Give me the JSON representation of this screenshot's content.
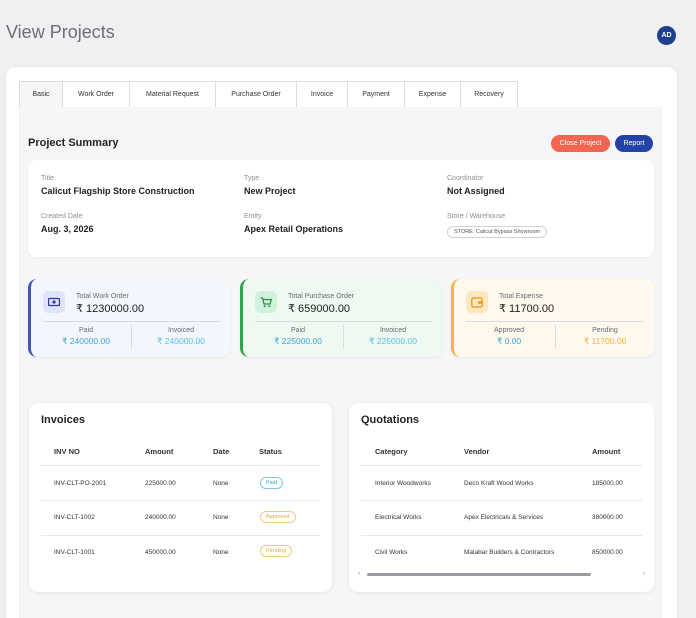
{
  "header": {
    "title": "View Projects",
    "avatar_initials": "AD"
  },
  "tabs": [
    {
      "label": "Basic",
      "active": true
    },
    {
      "label": "Work Order"
    },
    {
      "label": "Material Request"
    },
    {
      "label": "Purchase Order"
    },
    {
      "label": "Invoice"
    },
    {
      "label": "Payment"
    },
    {
      "label": "Expense"
    },
    {
      "label": "Recovery"
    }
  ],
  "summary": {
    "title": "Project Summary",
    "close_label": "Close Project",
    "report_label": "Report",
    "fields": {
      "title_label": "Title",
      "title_value": "Calicut Flagship Store Construction",
      "type_label": "Type",
      "type_value": "New Project",
      "coordinator_label": "Coordinator",
      "coordinator_value": "Not Assigned",
      "created_label": "Created Date",
      "created_value": "Aug. 3, 2026",
      "entity_label": "Entity",
      "entity_value": "Apex Retail Operations",
      "store_label": "Store / Warehouse",
      "store_value": "STORE: Calicut Bypass Showroom"
    }
  },
  "stats": {
    "work_order": {
      "label": "Total Work Order",
      "value": "₹ 1230000.00",
      "sub1_label": "Paid",
      "sub1_value": "₹ 240000.00",
      "sub2_label": "Invoiced",
      "sub2_value": "₹ 240000.00"
    },
    "purchase_order": {
      "label": "Total Purchase Order",
      "value": "₹ 659000.00",
      "sub1_label": "Paid",
      "sub1_value": "₹ 225000.00",
      "sub2_label": "Invoiced",
      "sub2_value": "₹ 225000.00"
    },
    "expense": {
      "label": "Total Expense",
      "value": "₹ 11700.00",
      "sub1_label": "Approved",
      "sub1_value": "₹ 0.00",
      "sub2_label": "Pending",
      "sub2_value": "₹ 11700.00"
    }
  },
  "colors": {
    "accent_blue": "#2342a8",
    "close_red": "#f26552",
    "paid_text": "#3fa6d8",
    "invoiced_text": "#4fc3e8",
    "approved_text": "#3fa6d8",
    "pending_text": "#f5b542"
  },
  "invoices": {
    "title": "Invoices",
    "headers": [
      "INV NO",
      "Amount",
      "Date",
      "Status"
    ],
    "rows": [
      {
        "inv": "INV-CLT-PO-2001",
        "amount": "225000.00",
        "date": "None",
        "status": "Paid"
      },
      {
        "inv": "INV-CLT-1002",
        "amount": "240000.00",
        "date": "None",
        "status": "Approved"
      },
      {
        "inv": "INV-CLT-1001",
        "amount": "450000.00",
        "date": "None",
        "status": "Pending"
      }
    ]
  },
  "quotations": {
    "title": "Quotations",
    "headers": [
      "Category",
      "Vendor",
      "Amount"
    ],
    "rows": [
      {
        "category": "Interior Woodworks",
        "vendor": "Deco Kraft Wood Works",
        "amount": "185000.00"
      },
      {
        "category": "Electrical Works",
        "vendor": "Apex Electricals & Services",
        "amount": "380000.00"
      },
      {
        "category": "Civil Works",
        "vendor": "Malabar Builders & Contractors",
        "amount": "850000.00"
      }
    ]
  }
}
